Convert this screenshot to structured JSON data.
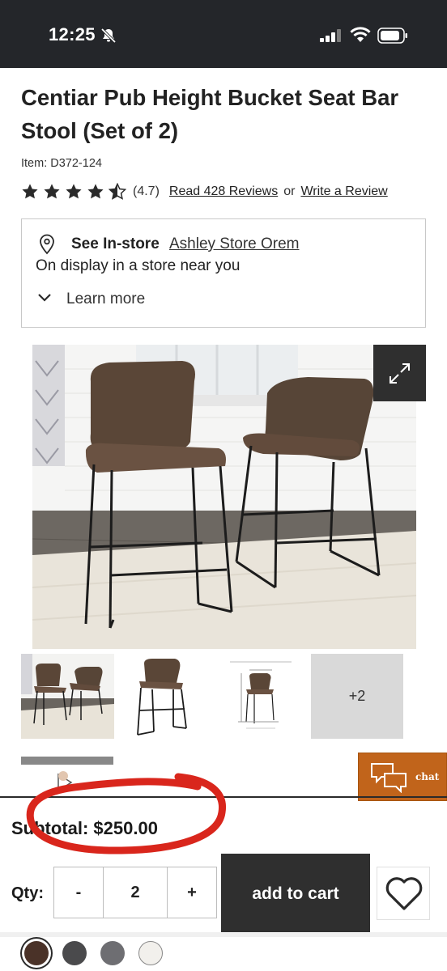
{
  "status_bar": {
    "time": "12:25"
  },
  "product": {
    "title": "Centiar Pub Height Bucket Seat Bar Stool (Set of 2)",
    "item_number": "Item: D372-124",
    "rating": 4.7,
    "rating_text": "(4.7)",
    "reviews_link": "Read 428 Reviews",
    "or_text": "or",
    "write_review_link": "Write a Review"
  },
  "store": {
    "see_in_store": "See In-store",
    "store_name": "Ashley Store Orem",
    "display_text": "On display in a store near you",
    "learn_more": "Learn more"
  },
  "gallery": {
    "more_count": "+2"
  },
  "chat": {
    "label": "chat"
  },
  "cart": {
    "subtotal": "Subtotal: $250.00",
    "qty_label": "Qty:",
    "qty_minus": "-",
    "qty_value": "2",
    "qty_plus": "+",
    "add_to_cart": "add to cart"
  },
  "swatches": {
    "colors": [
      "#4a3228",
      "#4a4a4c",
      "#6e6e72",
      "#f2f0ec"
    ]
  },
  "colors": {
    "dark": "#24262a",
    "chat": "#c1641b",
    "annotation": "#d9261c"
  }
}
